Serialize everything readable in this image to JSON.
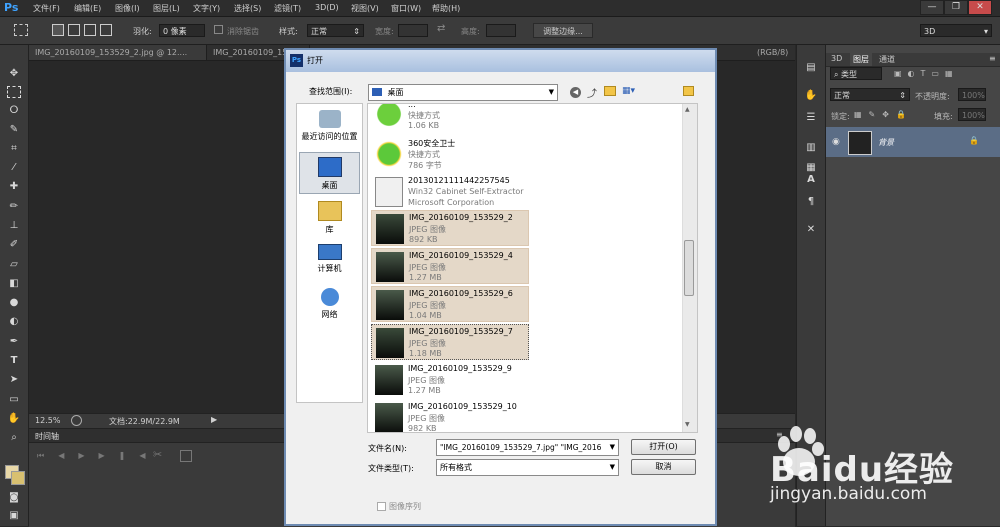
{
  "app": {
    "logo": "Ps",
    "menu": [
      "文件(F)",
      "编辑(E)",
      "图像(I)",
      "图层(L)",
      "文字(Y)",
      "选择(S)",
      "滤镜(T)",
      "3D(D)",
      "视图(V)",
      "窗口(W)",
      "帮助(H)"
    ],
    "window_buttons": [
      "—",
      "❐",
      "✕"
    ]
  },
  "options_bar": {
    "feather_label": "羽化:",
    "feather_value": "0 像素",
    "antialias_label": "消除锯齿",
    "style_label": "样式:",
    "style_value": "正常",
    "width_label": "宽度:",
    "height_label": "高度:",
    "refine_edge": "调整边缘...",
    "workspace": "3D"
  },
  "doc_tabs": [
    "IMG_20160109_153529_2.jpg @ 12....",
    "IMG_20160109_153529_..."
  ],
  "doc_tab_partial": "(RGB/8)",
  "status": {
    "zoom": "12.5%",
    "doc_info": "文档:22.9M/22.9M"
  },
  "timeline": {
    "title": "时间轴"
  },
  "layers_panel": {
    "tabs": [
      "3D",
      "图层",
      "通道"
    ],
    "filter_kind": "类型",
    "blend_mode": "正常",
    "opacity_label": "不透明度:",
    "opacity_value": "100%",
    "lock_label": "锁定:",
    "fill_label": "填充:",
    "fill_value": "100%",
    "layer_name": "背景"
  },
  "dialog": {
    "title": "打开",
    "look_in_label": "查找范围(I):",
    "look_in_value": "桌面",
    "places": [
      "最近访问的位置",
      "桌面",
      "库",
      "计算机",
      "网络"
    ],
    "files": [
      {
        "name": "...",
        "type": "快捷方式",
        "size": "1.06 KB",
        "selected": false
      },
      {
        "name": "360安全卫士",
        "type": "快捷方式",
        "size": "786 字节",
        "selected": false
      },
      {
        "name": "20130121111442257545",
        "type": "Win32 Cabinet Self-Extractor",
        "size": "Microsoft Corporation",
        "selected": false
      },
      {
        "name": "IMG_20160109_153529_2",
        "type": "JPEG 图像",
        "size": "892 KB",
        "selected": true
      },
      {
        "name": "IMG_20160109_153529_4",
        "type": "JPEG 图像",
        "size": "1.27 MB",
        "selected": true
      },
      {
        "name": "IMG_20160109_153529_6",
        "type": "JPEG 图像",
        "size": "1.04 MB",
        "selected": true
      },
      {
        "name": "IMG_20160109_153529_7",
        "type": "JPEG 图像",
        "size": "1.18 MB",
        "selected": true
      },
      {
        "name": "IMG_20160109_153529_9",
        "type": "JPEG 图像",
        "size": "1.27 MB",
        "selected": false
      },
      {
        "name": "IMG_20160109_153529_10",
        "type": "JPEG 图像",
        "size": "982 KB",
        "selected": false
      }
    ],
    "filename_label": "文件名(N):",
    "filename_value": "\"IMG_20160109_153529_7.jpg\" \"IMG_2016",
    "filetype_label": "文件类型(T):",
    "filetype_value": "所有格式",
    "open_button": "打开(O)",
    "cancel_button": "取消",
    "image_sequence": "图像序列"
  },
  "watermark": {
    "brand": "Baidu经验",
    "url": "jingyan.baidu.com"
  },
  "colors": {
    "ps_blue": "#3fa3ff",
    "selection": "#e4d8c8",
    "dialog_border": "#6e8bb2"
  }
}
